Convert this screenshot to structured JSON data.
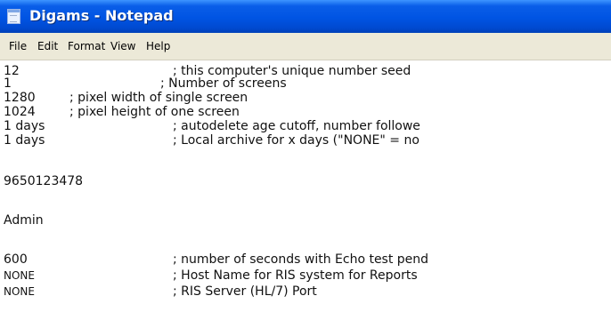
{
  "window": {
    "title": "Digams - Notepad",
    "icon": "notepad-icon"
  },
  "menu": [
    "File",
    "Edit",
    "Format",
    "View",
    "Help"
  ],
  "lines": [
    {
      "value": "12",
      "comment": "; this computer's unique number seed"
    },
    {
      "value": "1",
      "comment": "; Number of screens"
    },
    {
      "value": "1280",
      "comment": "; pixel width of single screen"
    },
    {
      "value": "1024",
      "comment": "; pixel height of one screen"
    },
    {
      "value": "1 days",
      "comment": "; autodelete age cutoff, number followe"
    },
    {
      "value": "1 days",
      "comment": "; Local archive for x days (\"NONE\" = no"
    },
    {
      "value": "9650123478",
      "comment": ""
    },
    {
      "value": "Admin",
      "comment": ""
    },
    {
      "value": "600",
      "comment": "; number of seconds with Echo test pend"
    },
    {
      "value": "NONE",
      "comment": "; Host Name for RIS system for Reports"
    },
    {
      "value": "NONE",
      "comment": "; RIS Server (HL/7) Port"
    }
  ]
}
